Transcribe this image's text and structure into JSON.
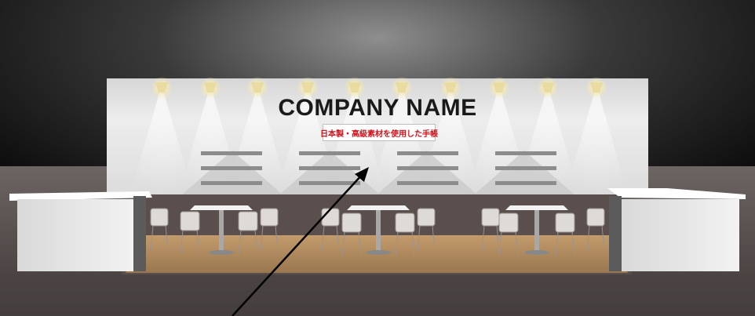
{
  "booth": {
    "company_name": "COMPANY NAME",
    "tagline": "日本製・高級素材を使用した手帳"
  },
  "colors": {
    "tagline_text": "#d0121b",
    "backwall": "#e4e4e4",
    "floor_carpet": "#b08a60",
    "stage_floor": "#5a4f4c"
  }
}
